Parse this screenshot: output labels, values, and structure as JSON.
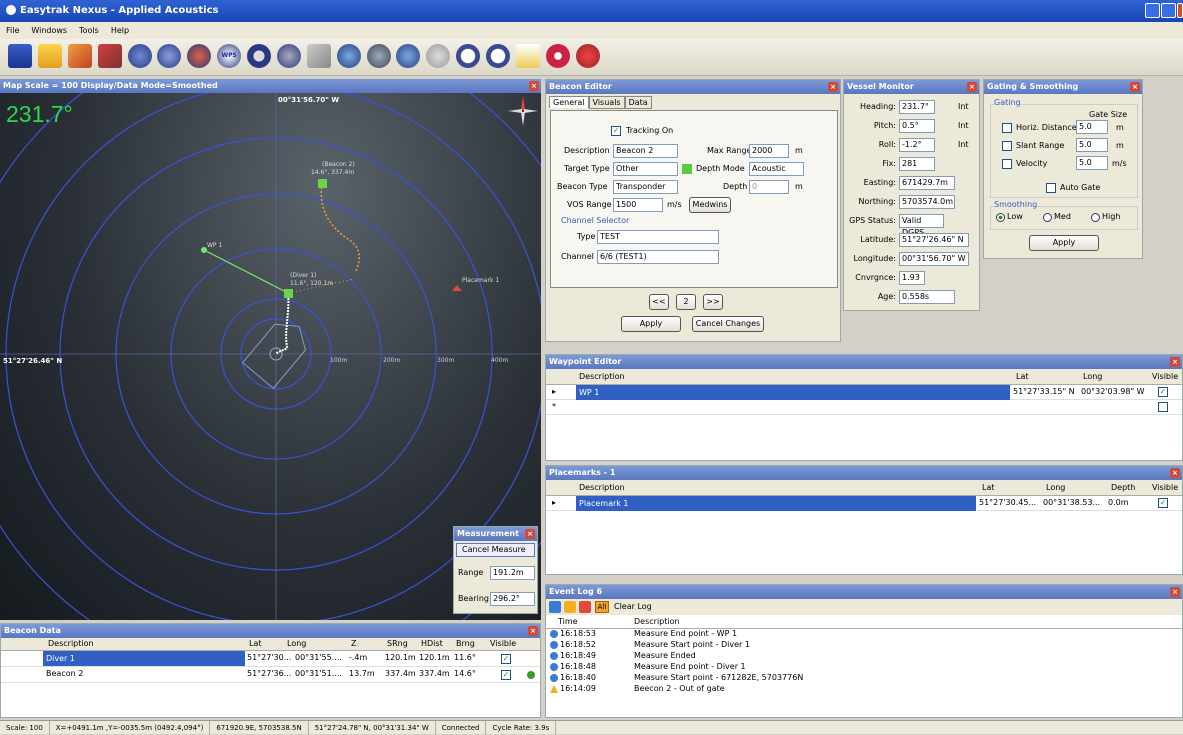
{
  "app": {
    "title": "Easytrak Nexus - Applied Acoustics"
  },
  "menu": [
    "File",
    "Windows",
    "Tools",
    "Help"
  ],
  "toolbar": {
    "icons": [
      "save-icon",
      "open-icon",
      "pen-icon",
      "wrench-icon",
      "circle-icon",
      "compass-icon",
      "gauge-icon",
      "wps-icon",
      "ring-icon",
      "satellite-icon",
      "pencil-icon",
      "globe-icon",
      "world-icon",
      "world2-icon",
      "grey-globe-icon",
      "zoom-in-icon",
      "zoom-out-icon",
      "ruler-icon",
      "pause-icon",
      "stop-icon"
    ],
    "wps_label": "WPS"
  },
  "map": {
    "title": "Map Scale = 100 Display/Data Mode=Smoothed",
    "heading": "231.7°",
    "top_coord": "00°31'56.70\" W",
    "left_coord": "51°27'26.46\" N",
    "range_labels": [
      "100m",
      "200m",
      "300m",
      "400m"
    ],
    "beacon2_label": "(Beacon 2)",
    "beacon2_info": "14.6°, 337.4m",
    "diver1_label": "(Diver 1)",
    "diver1_info": "11.6°, 120.1m",
    "wp1_label": "WP 1",
    "placemark_label": "Placemark 1"
  },
  "measurement": {
    "title": "Measurement",
    "cancel": "Cancel Measure",
    "range_label": "Range",
    "range_value": "191.2m",
    "bearing_label": "Bearing",
    "bearing_value": "296.2°"
  },
  "beacon_editor": {
    "title": "Beacon Editor",
    "tabs": [
      "General",
      "Visuals",
      "Data"
    ],
    "tracking_label": "Tracking On",
    "description_label": "Description",
    "description_value": "Beacon 2",
    "max_range_label": "Max Range",
    "max_range_value": "2000",
    "max_range_unit": "m",
    "target_type_label": "Target Type",
    "target_type_value": "Other",
    "depth_mode_label": "Depth Mode",
    "depth_mode_value": "Acoustic",
    "beacon_type_label": "Beacon Type",
    "beacon_type_value": "Transponder",
    "depth_label": "Depth",
    "depth_value": "0",
    "depth_unit": "m",
    "vos_label": "VOS Range",
    "vos_value": "1500",
    "vos_unit": "m/s",
    "medwins": "Medwins",
    "channel_selector": "Channel Selector",
    "type_label": "Type",
    "type_value": "TEST",
    "channel_label": "Channel",
    "channel_value": "6/6 (TEST1)",
    "prev": "<<",
    "page": "2",
    "next": ">>",
    "apply": "Apply",
    "cancel": "Cancel Changes"
  },
  "vessel": {
    "title": "Vessel Monitor",
    "rows": [
      {
        "label": "Heading:",
        "value": "231.7°",
        "unit": "Int"
      },
      {
        "label": "Pitch:",
        "value": "0.5°",
        "unit": "Int"
      },
      {
        "label": "Roll:",
        "value": "-1.2°",
        "unit": "Int"
      },
      {
        "label": "Fix:",
        "value": "281",
        "unit": ""
      },
      {
        "label": "Easting:",
        "value": "671429.7m",
        "unit": ""
      },
      {
        "label": "Northing:",
        "value": "5703574.0m",
        "unit": ""
      },
      {
        "label": "GPS Status:",
        "value": "Valid DGPS",
        "unit": ""
      },
      {
        "label": "Latitude:",
        "value": "51°27'26.46\" N",
        "unit": ""
      },
      {
        "label": "Longitude:",
        "value": "00°31'56.70\" W",
        "unit": ""
      },
      {
        "label": "Cnvrgnce:",
        "value": "1.93",
        "unit": ""
      },
      {
        "label": "Age:",
        "value": "0.558s",
        "unit": ""
      }
    ]
  },
  "gating": {
    "title": "Gating & Smoothing",
    "gating_label": "Gating",
    "gate_size": "Gate Size",
    "rows": [
      {
        "label": "Horiz. Distance",
        "value": "5.0",
        "unit": "m"
      },
      {
        "label": "Slant Range",
        "value": "5.0",
        "unit": "m"
      },
      {
        "label": "Velocity",
        "value": "5.0",
        "unit": "m/s"
      }
    ],
    "auto_gate": "Auto Gate",
    "smoothing": "Smoothing",
    "low": "Low",
    "med": "Med",
    "high": "High",
    "apply": "Apply"
  },
  "waypoint": {
    "title": "Waypoint Editor",
    "cols": [
      "Description",
      "Lat",
      "Long",
      "Visible"
    ],
    "row": {
      "desc": "WP 1",
      "lat": "51°27'33.15\" N",
      "long": "00°32'03.98\" W"
    }
  },
  "placemarks": {
    "title": "Placemarks - 1",
    "cols": [
      "Description",
      "Lat",
      "Long",
      "Depth",
      "Visible"
    ],
    "row": {
      "desc": "Placemark 1",
      "lat": "51°27'30.45...",
      "long": "00°31'38.53...",
      "depth": "0.0m"
    }
  },
  "beacon_data": {
    "title": "Beacon Data",
    "cols": [
      "Description",
      "Lat",
      "Long",
      "Z",
      "SRng",
      "HDist",
      "Brng",
      "Visible"
    ],
    "rows": [
      {
        "desc": "Diver 1",
        "lat": "51°27'30...",
        "long": "00°31'55....",
        "z": "-.4m",
        "srng": "120.1m",
        "hdist": "120.1m",
        "brng": "11.6°"
      },
      {
        "desc": "Beacon 2",
        "lat": "51°27'36...",
        "long": "00°31'51....",
        "z": "13.7m",
        "srng": "337.4m",
        "hdist": "337.4m",
        "brng": "14.6°"
      }
    ]
  },
  "event_log": {
    "title": "Event Log 6",
    "all": "All",
    "clear": "Clear Log",
    "cols": [
      "Time",
      "Description"
    ],
    "rows": [
      {
        "time": "16:18:53",
        "desc": "Measure End point - WP 1"
      },
      {
        "time": "16:18:52",
        "desc": "Measure Start point - Diver 1"
      },
      {
        "time": "16:18:49",
        "desc": "Measure Ended"
      },
      {
        "time": "16:18:48",
        "desc": "Measure End point - Diver 1"
      },
      {
        "time": "16:18:40",
        "desc": "Measure Start point - 671282E, 5703776N"
      },
      {
        "time": "16:14:09",
        "desc": "Beecon 2 - Out of gate"
      }
    ]
  },
  "status": [
    "Scale: 100",
    "X=+0491.1m ,Y=-0035.5m (0492.4,094°)",
    "671920.9E, 5703538.5N",
    "51°27'24.78\" N, 00°31'31.34\" W",
    "Connected",
    "Cycle Rate: 3.9s"
  ],
  "colors": {
    "title_blue": "#1a46b5",
    "panel_title": "#5a77c0",
    "select": "#3160c4",
    "heading": "#2fd84a"
  }
}
